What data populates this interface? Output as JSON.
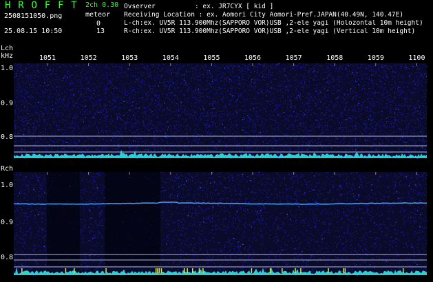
{
  "header": {
    "brand": "H R O F F T",
    "mode": "2ch 0.30",
    "filename": "2508151050.png",
    "meteor_label": "meteor",
    "count_l": "0",
    "count_r": "13",
    "datetime": "25.08.15 10:50",
    "observer_line": "Ovserver          : ex. JR7CYX [ kid ]",
    "location_line": "Receiving Location : ex. Aomori City Aomori-Pref.JAPAN(40.49N, 140.47E)",
    "lch_line": "L-ch:ex. UV5R 113.900Mhz(SAPPORO VOR)USB ,2-ele yagi (Holozontal 10m height)",
    "rch_line": "R-ch:ex. UV5R 113.900Mhz(SAPPORO VOR)USB ,2-ele yagi (Vertical 10m height)"
  },
  "axis": {
    "freq_ticks": [
      "1051",
      "1052",
      "1053",
      "1054",
      "1055",
      "1056",
      "1057",
      "1058",
      "1059",
      "1100"
    ],
    "lch_label": "Lch",
    "khz_label": "kHz",
    "rch_label": "Rch",
    "lch_yticks": [
      "1.0",
      "0.9",
      "0.8"
    ],
    "rch_yticks": [
      "1.0",
      "0.9",
      "0.8"
    ]
  },
  "colors": {
    "brand": "#33ff33",
    "text": "#66ffff",
    "noise": "#14148c",
    "trace": "#4fa8ff",
    "spectrum": "#2ee6e6"
  }
}
